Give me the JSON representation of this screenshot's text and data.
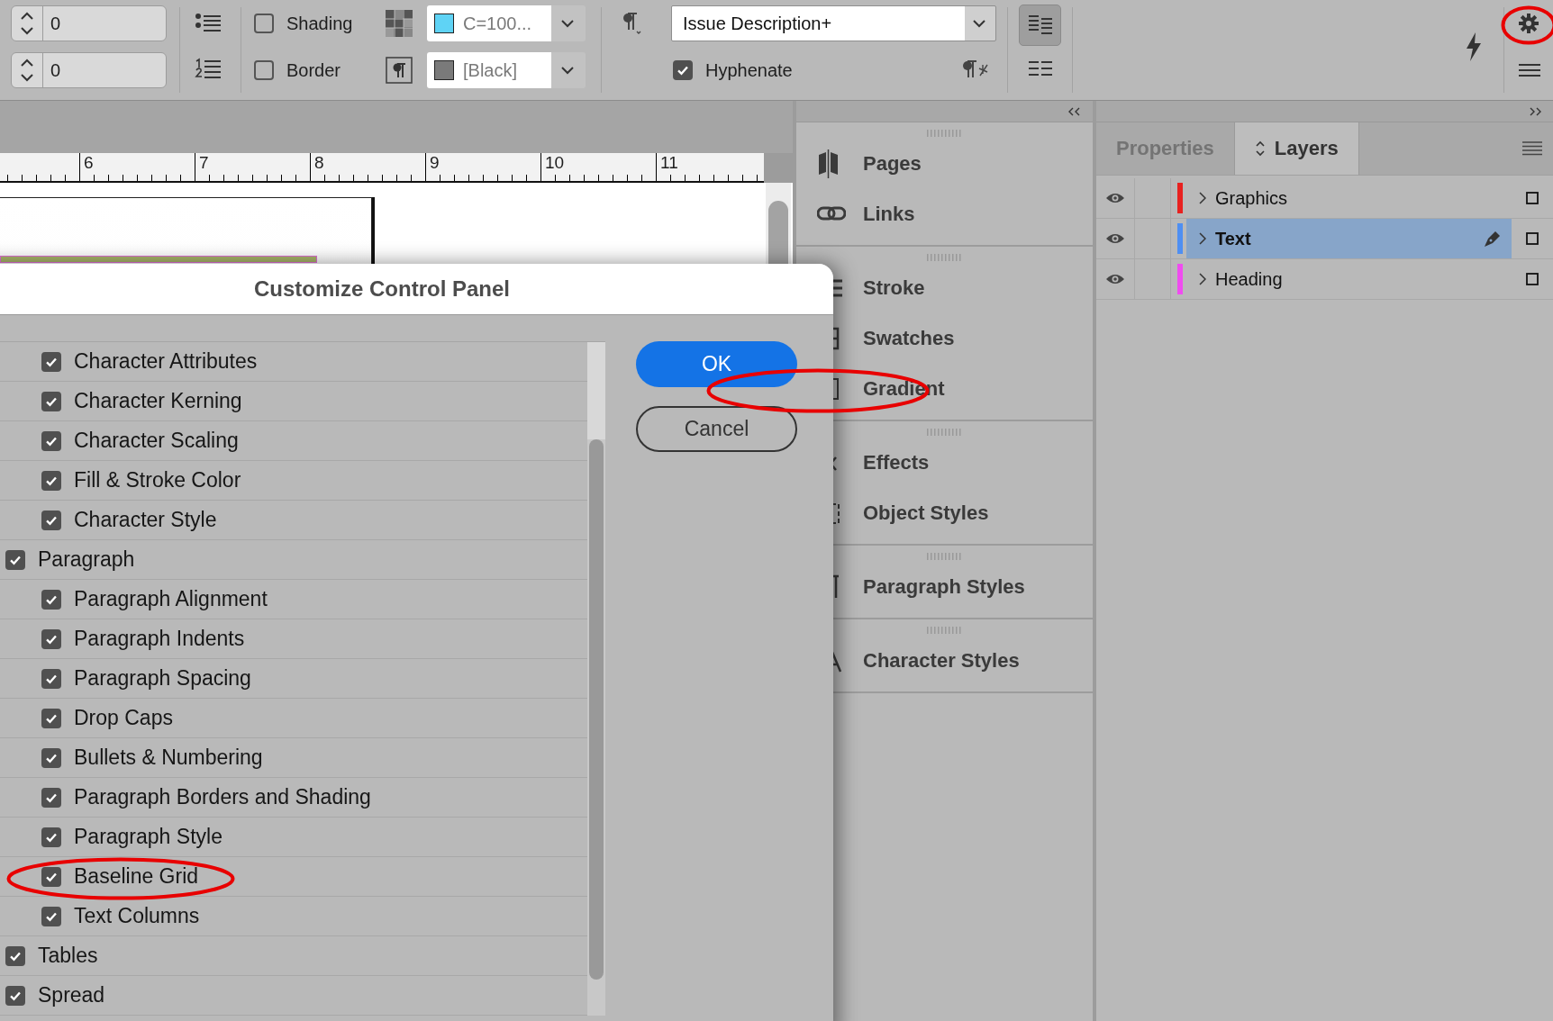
{
  "toolbar": {
    "spinners": [
      {
        "value": "0"
      },
      {
        "value": "0"
      }
    ],
    "checkboxes": [
      {
        "label": "Shading",
        "checked": false
      },
      {
        "label": "Border",
        "checked": false
      }
    ],
    "color_dropdowns": [
      {
        "value": "C=100...",
        "color": "#5fd3f5"
      },
      {
        "value": "[Black]",
        "color": "#7a7a7a"
      }
    ],
    "style_dropdown": {
      "value": "Issue Description+"
    },
    "hyphenate": {
      "label": "Hyphenate",
      "checked": true
    },
    "column_toggle": {
      "selected": true
    },
    "settings_button": {
      "circled": true
    }
  },
  "ruler": {
    "labels": [
      "6",
      "7",
      "8",
      "9",
      "10",
      "11"
    ]
  },
  "dock": {
    "sections": [
      {
        "items": [
          {
            "label": "Pages",
            "circled": false
          },
          {
            "label": "Links",
            "circled": false
          }
        ]
      },
      {
        "items": [
          {
            "label": "Stroke",
            "circled": false
          },
          {
            "label": "Swatches",
            "circled": false
          },
          {
            "label": "Gradient",
            "circled": true
          }
        ]
      },
      {
        "items": [
          {
            "label": "Effects",
            "circled": false
          },
          {
            "label": "Object Styles",
            "circled": false
          }
        ]
      },
      {
        "items": [
          {
            "label": "Paragraph Styles",
            "circled": false
          }
        ]
      },
      {
        "items": [
          {
            "label": "Character Styles",
            "circled": false
          }
        ]
      }
    ]
  },
  "layers_panel": {
    "tabs": [
      {
        "label": "Properties",
        "selected": false
      },
      {
        "label": "Layers",
        "selected": true
      }
    ],
    "layers": [
      {
        "name": "Graphics",
        "color": "#e8211f",
        "visible": true,
        "selected": false
      },
      {
        "name": "Text",
        "color": "#4f8ff2",
        "visible": true,
        "selected": true
      },
      {
        "name": "Heading",
        "color": "#f04cf0",
        "visible": true,
        "selected": false
      }
    ]
  },
  "dialog": {
    "title": "Customize Control Panel",
    "continued_children": [
      {
        "label": "Character Attributes",
        "checked": true,
        "circled": false
      },
      {
        "label": "Character Kerning",
        "checked": true,
        "circled": false
      },
      {
        "label": "Character Scaling",
        "checked": true,
        "circled": false
      },
      {
        "label": "Fill & Stroke Color",
        "checked": true,
        "circled": false
      },
      {
        "label": "Character Style",
        "checked": true,
        "circled": false
      }
    ],
    "options": [
      {
        "label": "Paragraph",
        "checked": true,
        "circled": false,
        "children": [
          {
            "label": "Paragraph Alignment",
            "checked": true,
            "circled": false
          },
          {
            "label": "Paragraph Indents",
            "checked": true,
            "circled": false
          },
          {
            "label": "Paragraph Spacing",
            "checked": true,
            "circled": false
          },
          {
            "label": "Drop Caps",
            "checked": true,
            "circled": false
          },
          {
            "label": "Bullets & Numbering",
            "checked": true,
            "circled": false
          },
          {
            "label": "Paragraph Borders and Shading",
            "checked": true,
            "circled": false
          },
          {
            "label": "Paragraph Style",
            "checked": true,
            "circled": false
          },
          {
            "label": "Baseline Grid",
            "checked": true,
            "circled": true
          },
          {
            "label": "Text Columns",
            "checked": true,
            "circled": false
          }
        ]
      },
      {
        "label": "Tables",
        "checked": true,
        "circled": false
      },
      {
        "label": "Spread",
        "checked": true,
        "circled": false
      }
    ],
    "buttons": [
      {
        "label": "OK",
        "kind": "primary"
      },
      {
        "label": "Cancel",
        "kind": "secondary"
      }
    ]
  }
}
